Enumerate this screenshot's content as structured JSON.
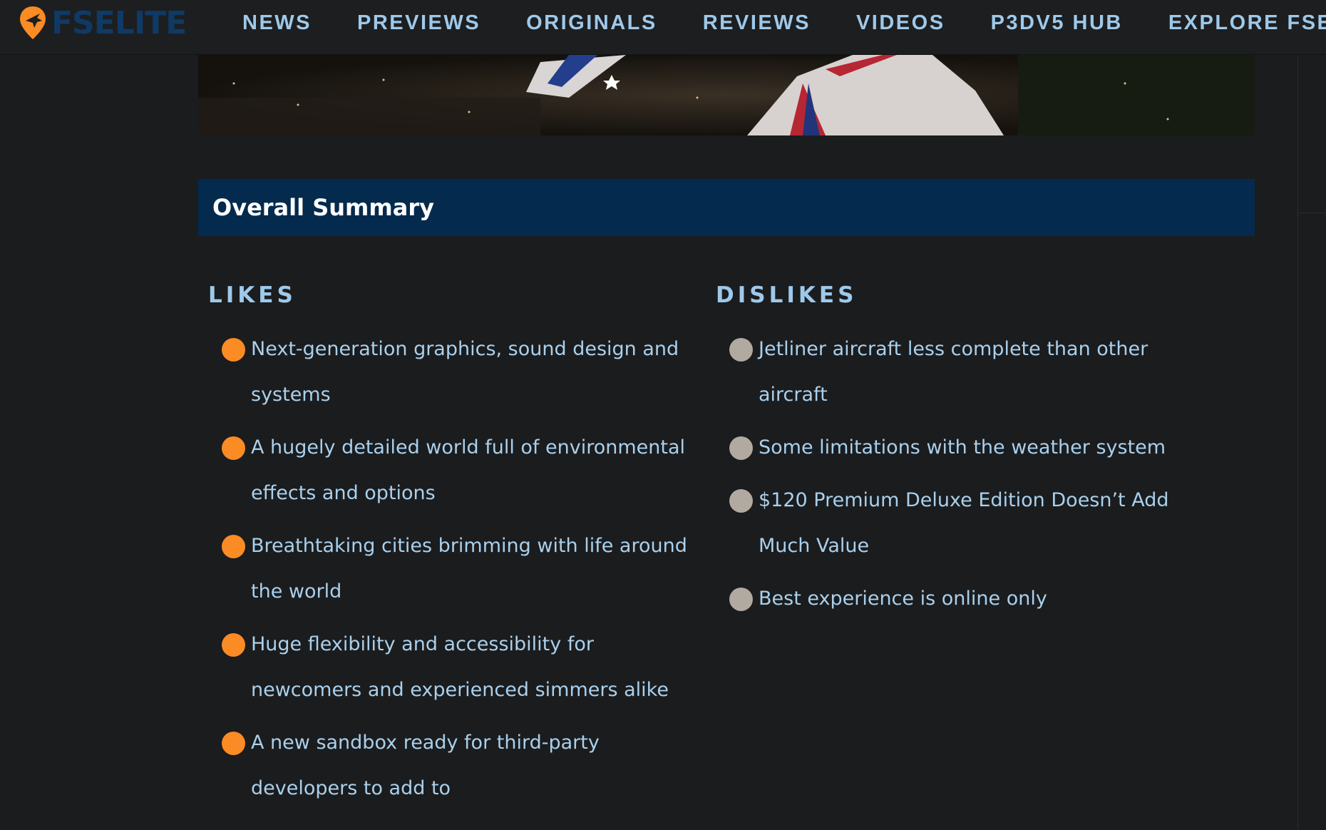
{
  "header": {
    "logo_text": "FSELITE",
    "nav": [
      {
        "label": "NEWS"
      },
      {
        "label": "PREVIEWS"
      },
      {
        "label": "ORIGINALS"
      },
      {
        "label": "REVIEWS"
      },
      {
        "label": "VIDEOS"
      },
      {
        "label": "P3DV5 HUB"
      },
      {
        "label": "EXPLORE FSELITE"
      }
    ]
  },
  "summary": {
    "title": "Overall Summary"
  },
  "likes": {
    "heading": "LIKES",
    "items": [
      "Next-generation graphics, sound design and systems",
      "A hugely detailed world full of environmental effects and options",
      "Breathtaking cities brimming with life around the world",
      "Huge flexibility and accessibility for newcomers and experienced simmers alike",
      "A new sandbox ready for third-party developers to add to"
    ]
  },
  "dislikes": {
    "heading": "DISLIKES",
    "items": [
      "Jetliner aircraft less complete than other aircraft",
      "Some limitations with the weather system",
      "$120 Premium Deluxe Edition Doesn’t Add Much Value",
      "Best experience is online only"
    ]
  },
  "colors": {
    "accent_orange": "#fb8b24",
    "link_blue": "#9ec9ea",
    "summary_bg": "#042a4d",
    "dislike_bullet": "#b1aaa0"
  }
}
